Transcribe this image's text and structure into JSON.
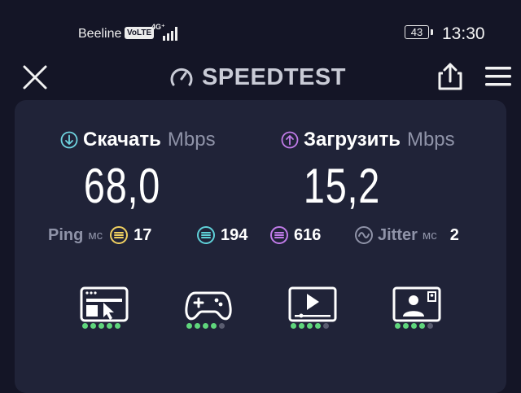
{
  "status_bar": {
    "carrier": "Beeline",
    "volte": "VoLTE",
    "network": "4G⁺",
    "battery": "43",
    "time": "13:30"
  },
  "header": {
    "title": "SPEEDTEST",
    "icons": [
      "close-icon",
      "speedometer-icon",
      "share-icon",
      "menu-icon"
    ]
  },
  "download": {
    "label": "Скачать",
    "unit": "Mbps",
    "value": "68,0",
    "icon_color": "#6fd4e0"
  },
  "upload": {
    "label": "Загрузить",
    "unit": "Mbps",
    "value": "15,2",
    "icon_color": "#c07be8"
  },
  "ping": {
    "label": "Ping",
    "unit": "мс",
    "idle": "17",
    "download": "194",
    "upload": "616"
  },
  "jitter": {
    "label": "Jitter",
    "unit": "мс",
    "value": "2"
  },
  "colors": {
    "background": "#141526",
    "card": "#202338",
    "idle_ping": "#f0d060",
    "download_ping": "#5fd0d8",
    "upload_ping": "#c07be8",
    "dot_on": "#5fd67c",
    "dot_off": "#5a5d70"
  },
  "experience": [
    {
      "icon": "web-browsing-icon",
      "rating": 5,
      "max": 5
    },
    {
      "icon": "gaming-icon",
      "rating": 4,
      "max": 5
    },
    {
      "icon": "video-streaming-icon",
      "rating": 4,
      "max": 5
    },
    {
      "icon": "video-call-icon",
      "rating": 4,
      "max": 5
    }
  ]
}
